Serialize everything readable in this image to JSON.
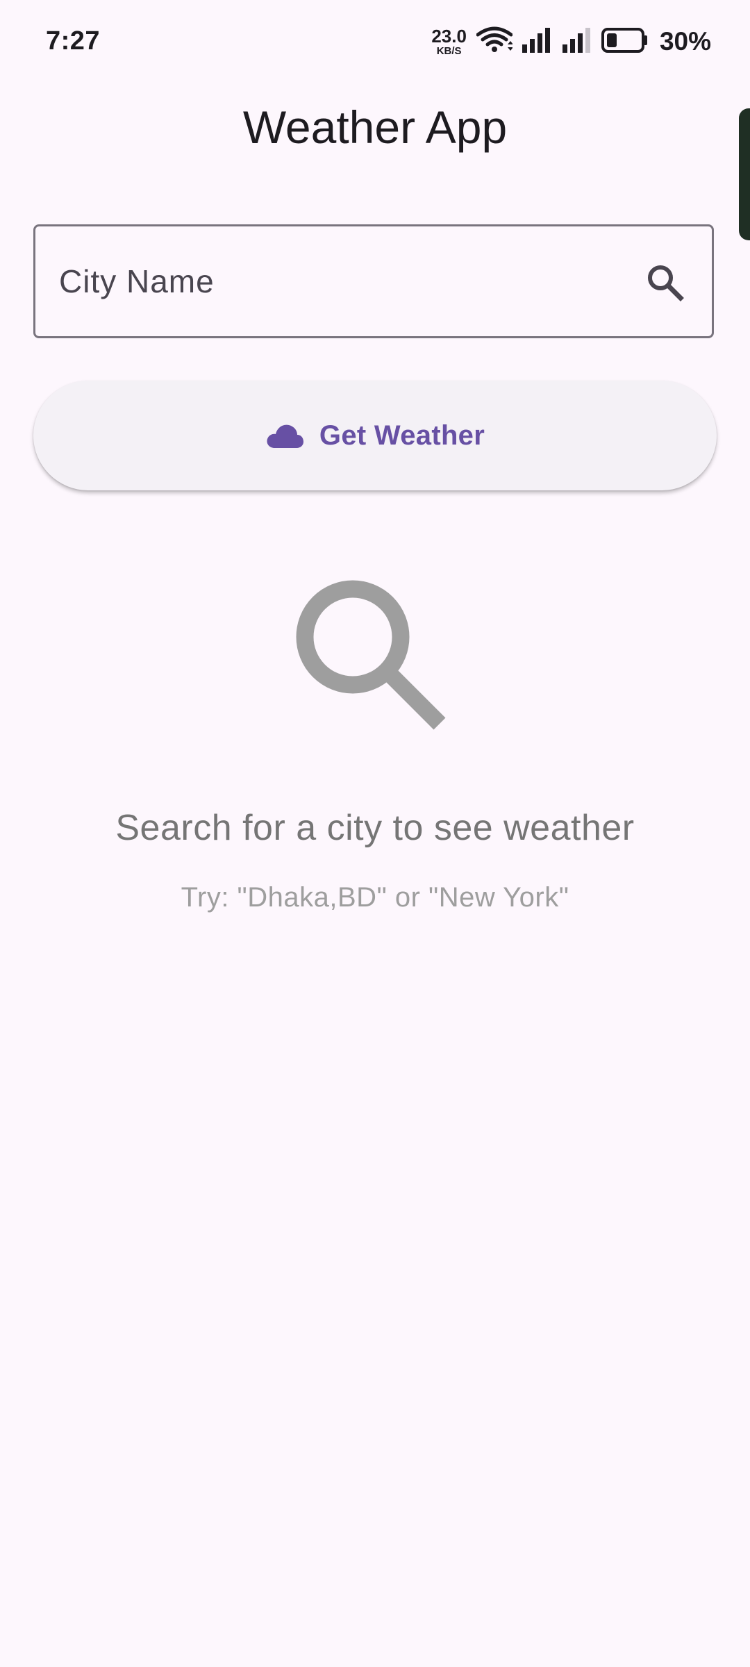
{
  "status_bar": {
    "time": "7:27",
    "net_speed_value": "23.0",
    "net_speed_unit": "KB/S",
    "battery_percent": "30%",
    "icons": [
      "wifi-icon",
      "signal-icon",
      "signal-icon",
      "battery-icon"
    ]
  },
  "app": {
    "title": "Weather App"
  },
  "search": {
    "placeholder": "City Name",
    "value": "",
    "icon": "search-icon"
  },
  "button": {
    "label": "Get Weather",
    "icon": "cloud-icon"
  },
  "empty_state": {
    "icon": "search-icon",
    "title": "Search for a city to see weather",
    "hint": "Try: \"Dhaka,BD\" or \"New York\""
  },
  "colors": {
    "background": "#fdf7fd",
    "primary": "#6750a4",
    "button_bg": "#f4f1f6",
    "outline": "#79747e",
    "empty_icon": "#9e9e9e",
    "empty_text": "#757575",
    "hint_text": "#9e9e9e"
  }
}
